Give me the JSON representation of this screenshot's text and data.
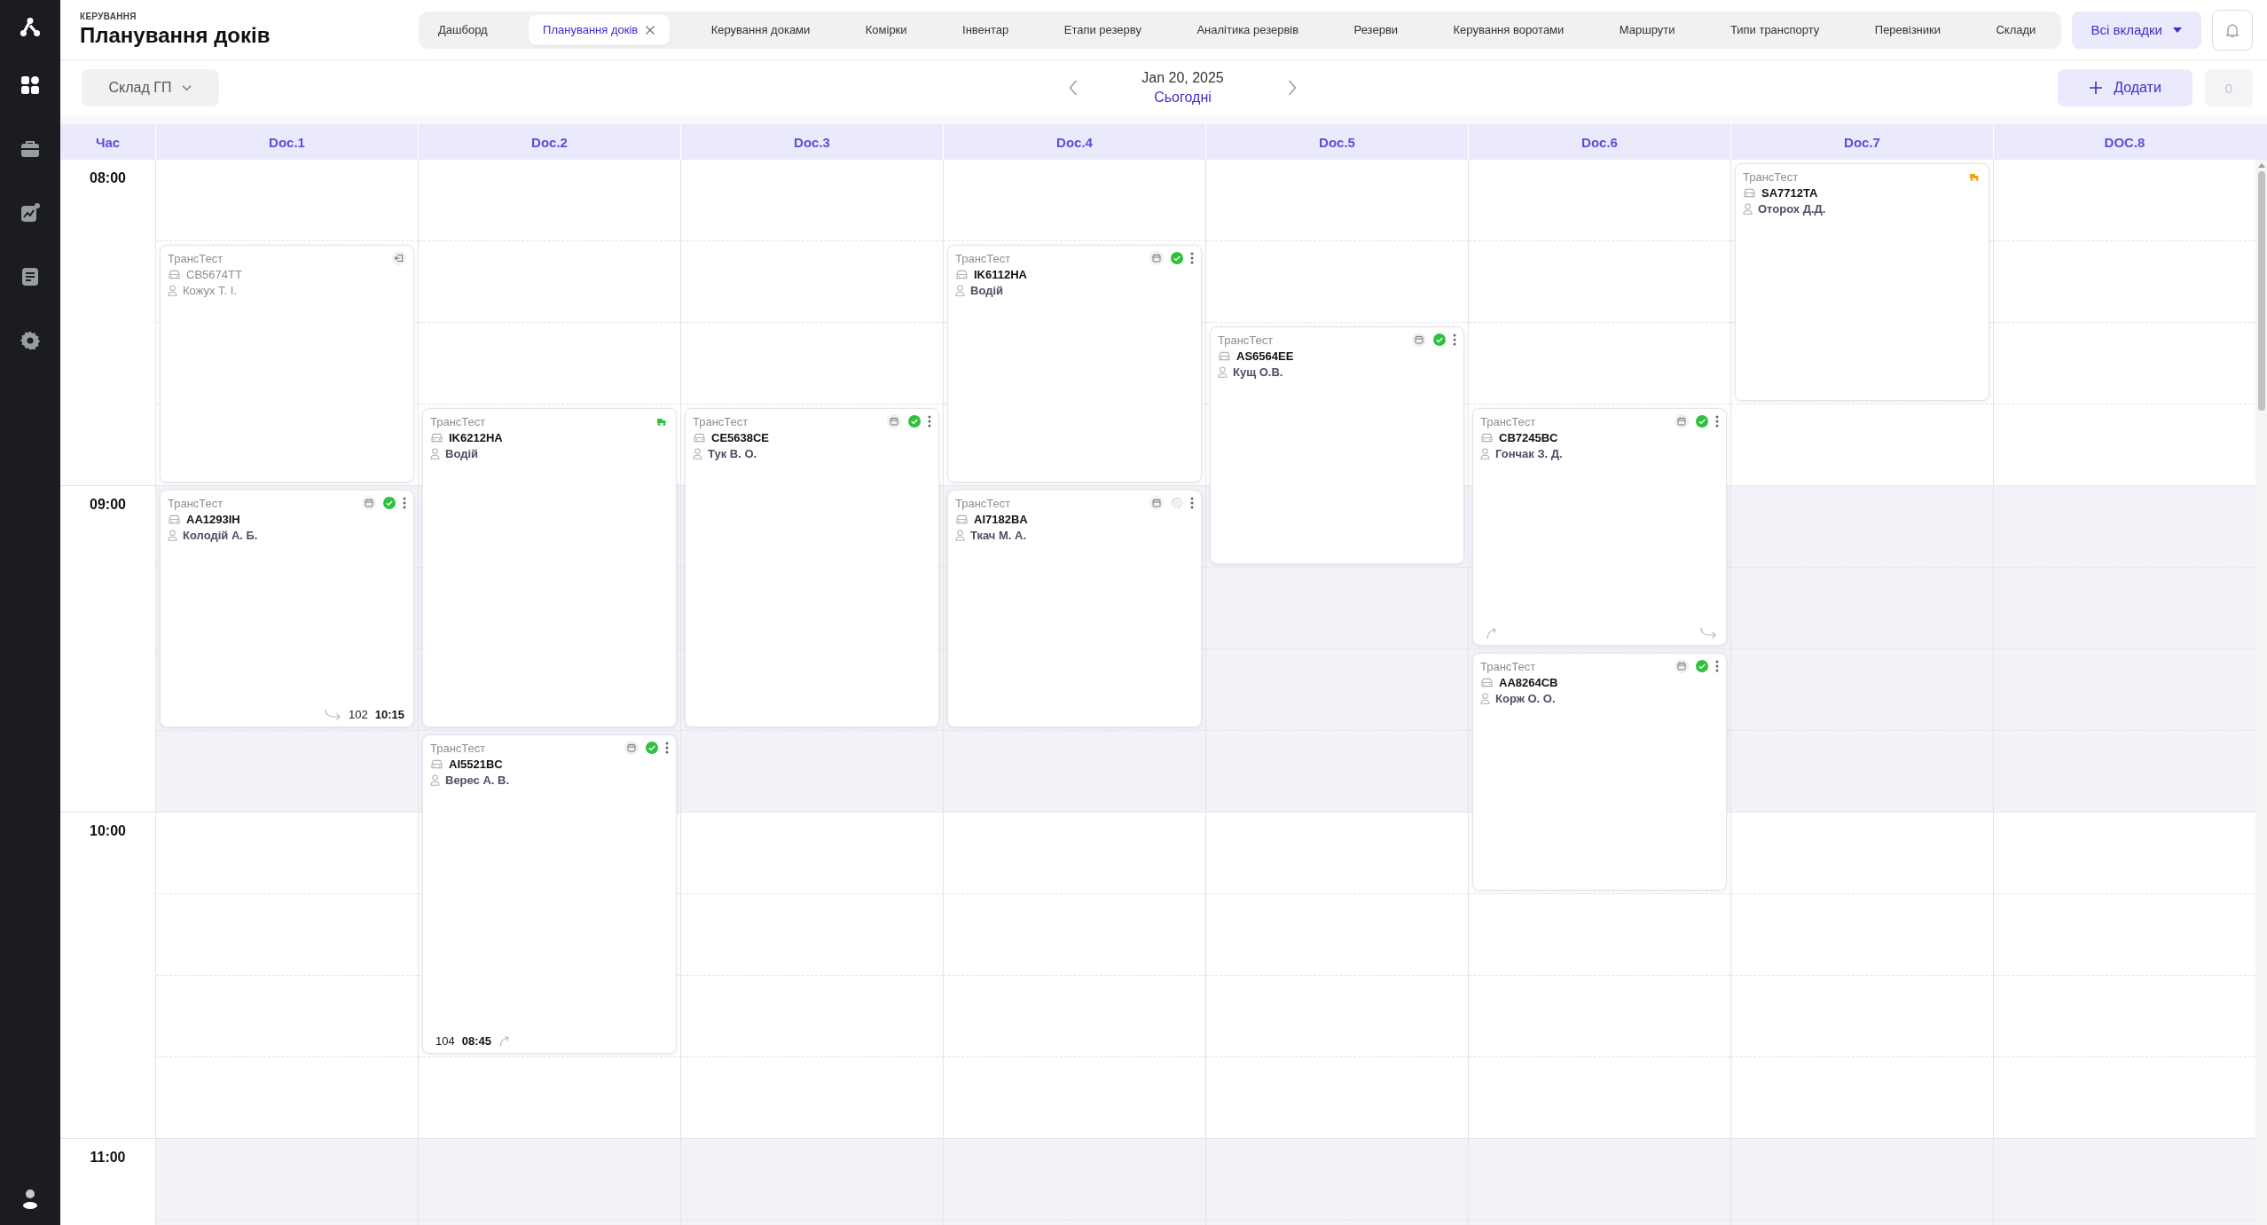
{
  "sidebar": {
    "items": [
      {
        "kind": "apps",
        "selected": true
      },
      {
        "kind": "briefcase",
        "selected": false
      },
      {
        "kind": "chart",
        "selected": false
      },
      {
        "kind": "list",
        "selected": false
      },
      {
        "kind": "settings",
        "selected": false
      }
    ]
  },
  "header": {
    "section": "КЕРУВАННЯ",
    "title": "Планування доків"
  },
  "tabs": [
    {
      "label": "Дашборд",
      "selected": false,
      "closable": false
    },
    {
      "label": "Планування доків",
      "selected": true,
      "closable": true
    },
    {
      "label": "Керування доками",
      "selected": false,
      "closable": false
    },
    {
      "label": "Комірки",
      "selected": false,
      "closable": false
    },
    {
      "label": "Інвентар",
      "selected": false,
      "closable": false
    },
    {
      "label": "Етапи резерву",
      "selected": false,
      "closable": false
    },
    {
      "label": "Аналітика резервів",
      "selected": false,
      "closable": false
    },
    {
      "label": "Резерви",
      "selected": false,
      "closable": false
    },
    {
      "label": "Керування воротами",
      "selected": false,
      "closable": false
    },
    {
      "label": "Маршрути",
      "selected": false,
      "closable": false
    },
    {
      "label": "Типи транспорту",
      "selected": false,
      "closable": false
    },
    {
      "label": "Перевізники",
      "selected": false,
      "closable": false
    },
    {
      "label": "Склади",
      "selected": false,
      "closable": false
    }
  ],
  "all_tabs_button": "Всі вкладки",
  "toolbar": {
    "warehouse": "Склад ГП",
    "date": "Jan 20, 2025",
    "today": "Сьогодні",
    "add_button": "Додати",
    "counter": {
      "text": "0",
      "disabled": true
    }
  },
  "calendar": {
    "time_header": "Час",
    "hours": [
      {
        "label": "08:00",
        "shaded": false
      },
      {
        "label": "09:00",
        "shaded": true
      },
      {
        "label": "10:00",
        "shaded": false
      },
      {
        "label": "11:00",
        "shaded": true
      }
    ],
    "columns": [
      {
        "name": "Doc.1",
        "slots": [
          {
            "kind": "gap"
          },
          {
            "kind": "short",
            "company": "ТрансТест",
            "plate": "CB5674TT",
            "driver": "Кожух Т. І.",
            "faded": true,
            "badge": {
              "kind": "exit"
            }
          },
          {
            "kind": "short",
            "company": "ТрансТест",
            "plate": "AA1293IH",
            "driver": "Колодій А. Б.",
            "faded": false,
            "badge": {
              "kind": "actions",
              "confirmed": true
            },
            "footer": [
              {
                "kind": "return"
              },
              {
                "kind": "number",
                "text": "102"
              },
              {
                "kind": "time",
                "text": "10:15"
              }
            ]
          }
        ]
      },
      {
        "name": "Doc.2",
        "slots": [
          {
            "kind": "gap"
          },
          {
            "kind": "gap"
          },
          {
            "kind": "gap"
          },
          {
            "kind": "long",
            "company": "ТрансТест",
            "plate": "IK6212HA",
            "driver": "Водій",
            "faded": false,
            "badge": {
              "kind": "truck",
              "color": "#2fc13e"
            }
          },
          {
            "kind": "long",
            "company": "ТрансТест",
            "plate": "AI5521BC",
            "driver": "Верес А. В.",
            "faded": false,
            "badge": {
              "kind": "actions",
              "confirmed": true
            },
            "footer": [
              {
                "kind": "number",
                "text": "104"
              },
              {
                "kind": "time",
                "text": "08:45"
              },
              {
                "kind": "up"
              },
              {
                "kind": "spacer"
              }
            ]
          }
        ]
      },
      {
        "name": "Doc.3",
        "slots": [
          {
            "kind": "gap"
          },
          {
            "kind": "gap"
          },
          {
            "kind": "gap"
          },
          {
            "kind": "long",
            "company": "ТрансТест",
            "plate": "CE5638CE",
            "driver": "Тук В. О.",
            "faded": false,
            "badge": {
              "kind": "actions",
              "confirmed": true
            }
          }
        ]
      },
      {
        "name": "Doc.4",
        "slots": [
          {
            "kind": "gap"
          },
          {
            "kind": "short",
            "company": "ТрансТест",
            "plate": "IK6112HA",
            "driver": "Водій",
            "faded": false,
            "badge": {
              "kind": "actions",
              "confirmed": true
            }
          },
          {
            "kind": "short",
            "company": "ТрансТест",
            "plate": "AI7182BA",
            "driver": "Ткач М. А.",
            "faded": false,
            "badge": {
              "kind": "actions",
              "confirmed": false
            }
          }
        ]
      },
      {
        "name": "Doc.5",
        "slots": [
          {
            "kind": "gap"
          },
          {
            "kind": "gap"
          },
          {
            "kind": "short",
            "company": "ТрансТест",
            "plate": "AS6564EE",
            "driver": "Кущ О.В.",
            "faded": false,
            "badge": {
              "kind": "actions",
              "confirmed": true
            }
          }
        ]
      },
      {
        "name": "Doc.6",
        "slots": [
          {
            "kind": "gap"
          },
          {
            "kind": "gap"
          },
          {
            "kind": "gap"
          },
          {
            "kind": "short",
            "company": "ТрансТест",
            "plate": "CB7245BC",
            "driver": "Гончак З. Д.",
            "faded": false,
            "badge": {
              "kind": "actions",
              "confirmed": true
            },
            "footer": [
              {
                "kind": "up"
              },
              {
                "kind": "spacer"
              },
              {
                "kind": "return"
              }
            ]
          },
          {
            "kind": "short",
            "company": "ТрансТест",
            "plate": "AA8264CB",
            "driver": "Корж О. О.",
            "faded": false,
            "badge": {
              "kind": "actions",
              "confirmed": true
            }
          }
        ]
      },
      {
        "name": "Doc.7",
        "slots": [
          {
            "kind": "short",
            "company": "ТрансТест",
            "plate": "SA7712TA",
            "driver": "Оторох Д.Д.",
            "faded": false,
            "badge": {
              "kind": "truck",
              "color": "#f5a10f"
            }
          }
        ]
      },
      {
        "name": "DOC.8"
      }
    ]
  }
}
